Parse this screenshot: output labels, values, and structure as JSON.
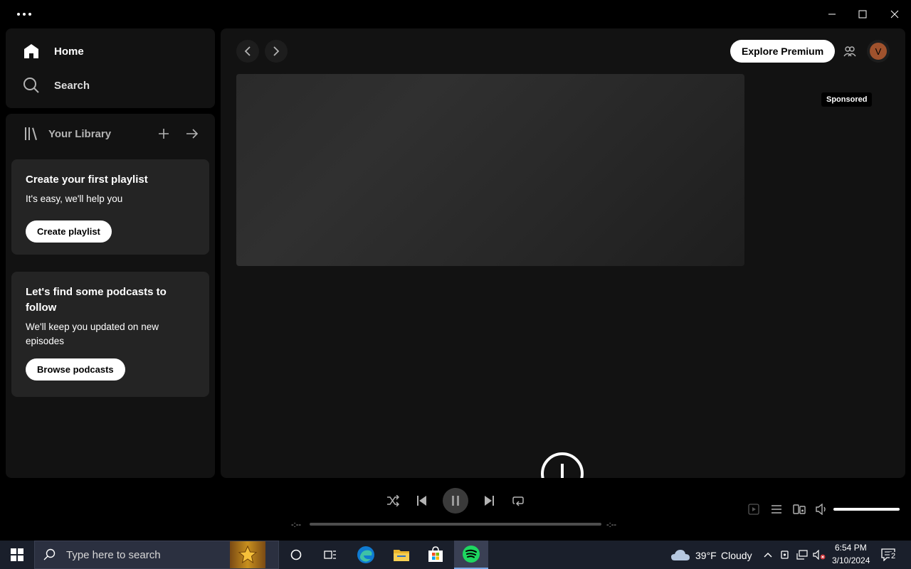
{
  "nav": {
    "home_label": "Home",
    "search_label": "Search"
  },
  "library": {
    "title": "Your Library",
    "cards": [
      {
        "title": "Create your first playlist",
        "text": "It's easy, we'll help you",
        "button": "Create playlist"
      },
      {
        "title": "Let's find some podcasts to follow",
        "text": "We'll keep you updated on new episodes",
        "button": "Browse podcasts"
      }
    ]
  },
  "main": {
    "premium_button": "Explore Premium",
    "avatar_initial": "V",
    "sponsored_label": "Sponsored"
  },
  "player": {
    "elapsed": "-:--",
    "duration": "-:--",
    "progress": 0,
    "volume": 1.0
  },
  "taskbar": {
    "search_placeholder": "Type here to search",
    "weather_temp": "39°F",
    "weather_desc": "Cloudy",
    "time": "6:54 PM",
    "date": "3/10/2024",
    "notifications": "2"
  },
  "colors": {
    "accent": "#1ed760",
    "background": "#121212",
    "card": "#242424"
  }
}
